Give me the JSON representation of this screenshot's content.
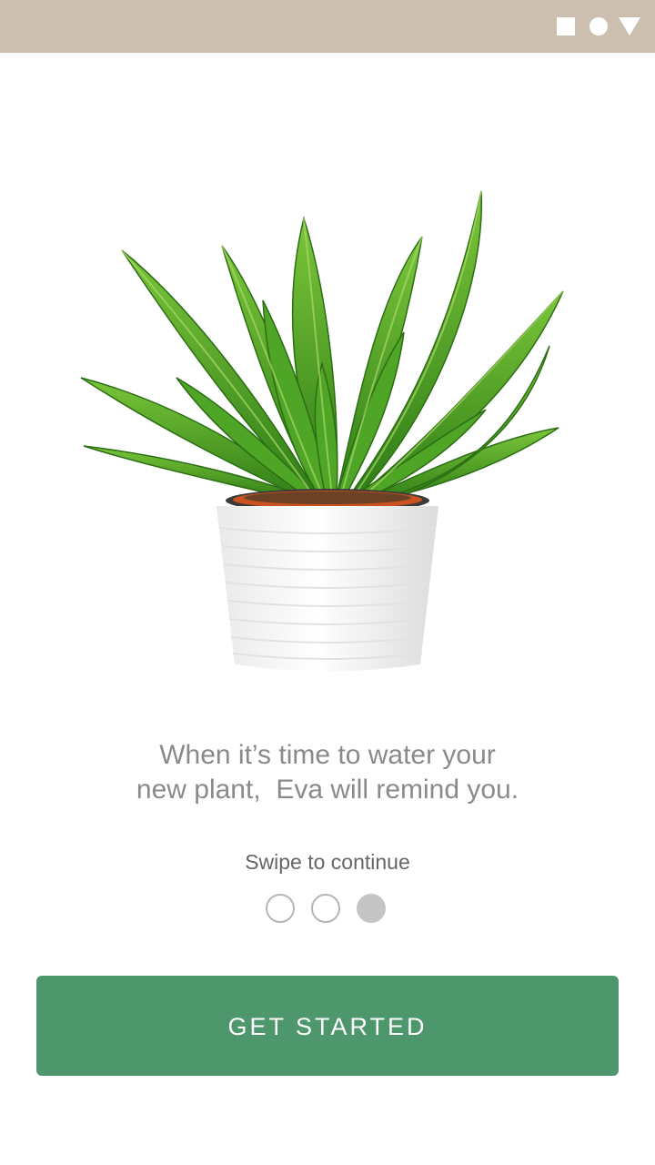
{
  "status_bar": {
    "color": "#cdbfb0",
    "icons": [
      "square-icon",
      "circle-icon",
      "triangle-icon"
    ]
  },
  "illustration": {
    "subject": "potted-fern-image"
  },
  "onboarding": {
    "message_line1": "When it’s time to water your",
    "message_line2": "new plant,  Eva will remind you.",
    "swipe_hint": "Swipe to continue",
    "page_count": 3,
    "active_page": 3
  },
  "cta": {
    "label": "GET STARTED",
    "color": "#4e976c"
  }
}
